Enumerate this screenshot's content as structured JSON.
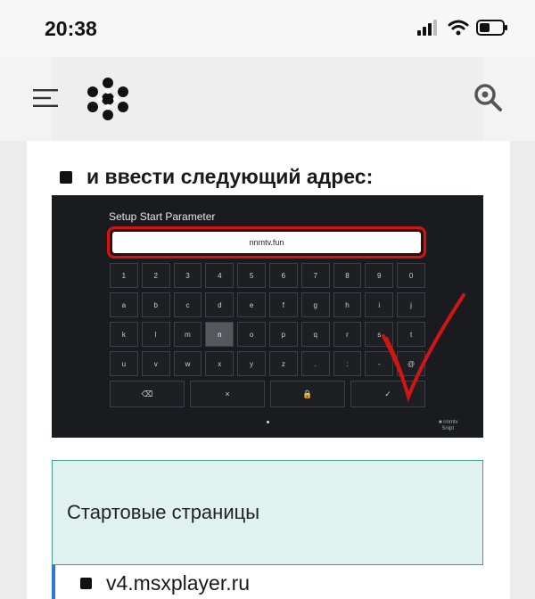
{
  "status_bar": {
    "time": "20:38"
  },
  "header": {
    "icons": {
      "menu": "hamburger-menu-icon",
      "logo": "snowflake-logo-icon",
      "search": "search-icon"
    }
  },
  "article": {
    "heading": "и ввести следующий адрес:",
    "screenshot": {
      "title": "Setup Start Parameter",
      "input_value": "nnmtv.fun",
      "key_rows": [
        [
          "1",
          "2",
          "3",
          "4",
          "5",
          "6",
          "7",
          "8",
          "9",
          "0"
        ],
        [
          "a",
          "b",
          "c",
          "d",
          "e",
          "f",
          "g",
          "h",
          "i",
          "j"
        ],
        [
          "k",
          "l",
          "m",
          "n",
          "o",
          "p",
          "q",
          "r",
          "s",
          "t"
        ],
        [
          "u",
          "v",
          "w",
          "x",
          "y",
          "z",
          ".",
          ":",
          "-",
          "@"
        ]
      ],
      "selected_key": "n",
      "bottom_keys": [
        "⌫",
        "×",
        "🔒",
        "✓"
      ],
      "watermark": "■ nnmtv\n  Snipt"
    },
    "note_title": "Стартовые страницы",
    "list_items": [
      "v4.msxplayer.ru"
    ]
  },
  "colors": {
    "accent_blue": "#2d7bd8",
    "note_bg": "#e0f2ef",
    "note_border": "#3aa08e",
    "highlight_red": "#d11414"
  }
}
